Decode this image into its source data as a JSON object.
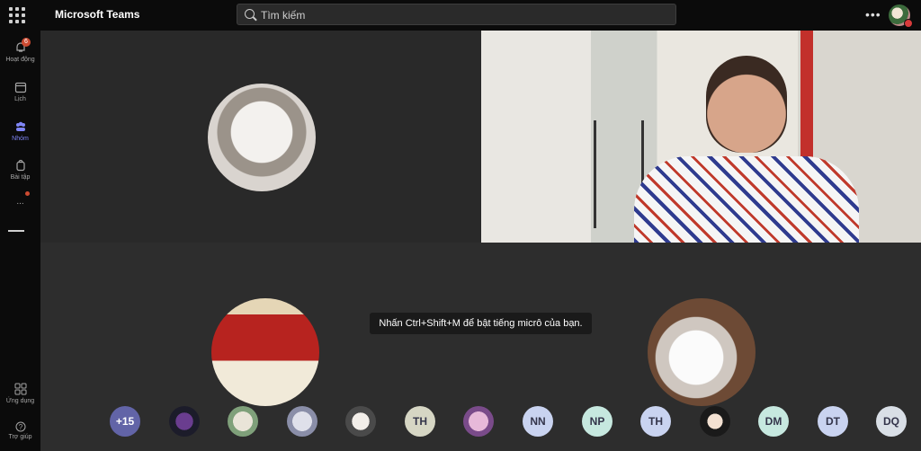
{
  "app": {
    "title": "Microsoft Teams"
  },
  "search": {
    "placeholder": "Tìm kiếm"
  },
  "rail": {
    "items": [
      {
        "label": "Hoạt động",
        "badge": "6",
        "icon": "bell-icon"
      },
      {
        "label": "Lịch",
        "icon": "calendar-icon"
      },
      {
        "label": "Nhóm",
        "icon": "teams-icon",
        "active": true
      },
      {
        "label": "Bài tập",
        "icon": "backpack-icon"
      },
      {
        "label": "...",
        "icon": "more-icon"
      }
    ],
    "apps_label": "Ứng dụng",
    "help_label": "Trợ giúp"
  },
  "meeting": {
    "mute_tooltip": "Nhấn Ctrl+Shift+M để bật tiếng micrô của bạn.",
    "overflow_count": "+15",
    "participants": [
      "TH",
      "NN",
      "NP",
      "TH",
      "DM",
      "DT",
      "DQ"
    ]
  },
  "colors": {
    "accent": "#6264a7",
    "badge": "#cc4a31",
    "active_nav": "#7f85f5"
  }
}
